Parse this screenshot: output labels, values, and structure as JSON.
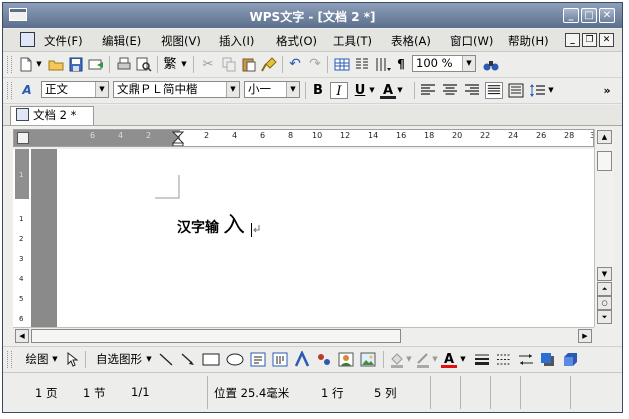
{
  "window": {
    "title": "WPS文字 - [文档 2 *]",
    "minimize": "_",
    "maximize": "□",
    "close": "✕"
  },
  "menu": [
    "文件(F)",
    "编辑(E)",
    "视图(V)",
    "插入(I)",
    "格式(O)",
    "工具(T)",
    "表格(A)",
    "窗口(W)",
    "帮助(H)"
  ],
  "mdi_controls": [
    "_",
    "❐",
    "✕"
  ],
  "standard_toolbar": {
    "traditional_label": "繁",
    "zoom": "100 %"
  },
  "format_toolbar": {
    "style": "正文",
    "font": "文鼎ＰＬ简中楷",
    "size": "小一",
    "bold": "B",
    "italic": "I",
    "underline": "U",
    "char_shading": "A"
  },
  "doc_tab": "文档 2 *",
  "ruler": {
    "left_numbers": [
      "6",
      "4",
      "2"
    ],
    "right_numbers": [
      "2",
      "4",
      "6",
      "8",
      "10",
      "12",
      "14",
      "16",
      "18",
      "20",
      "22",
      "24",
      "26",
      "28",
      "3"
    ],
    "vertical_numbers": [
      "1",
      "1",
      "2",
      "3",
      "4",
      "5",
      "6"
    ]
  },
  "document": {
    "text": "汉字输",
    "ime_char": "入"
  },
  "draw_toolbar": {
    "draw_label": "绘图",
    "autoshape_label": "自选图形"
  },
  "status": {
    "page": "1 页",
    "section": "1 节",
    "page_of": "1/1",
    "position": "位置 25.4毫米",
    "line": "1 行",
    "column": "5 列"
  }
}
